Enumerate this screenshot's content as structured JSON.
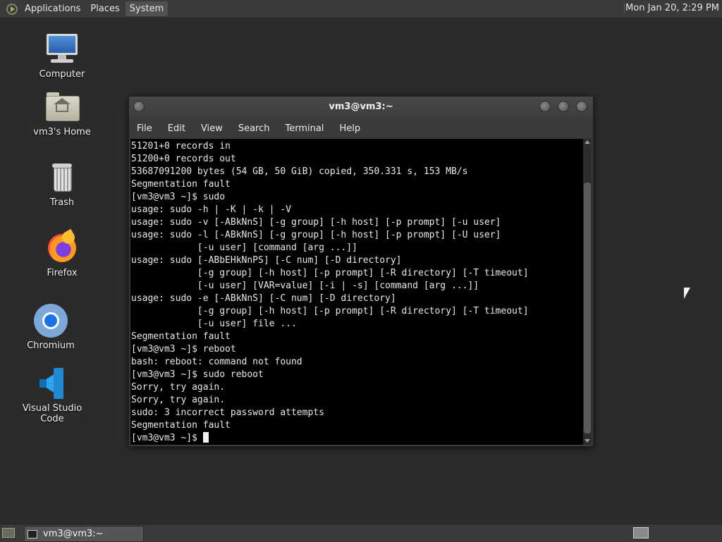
{
  "top_panel": {
    "menus": [
      "Applications",
      "Places",
      "System"
    ],
    "clock": "Mon Jan 20,  2:29 PM"
  },
  "desktop_icons": [
    {
      "label": "Computer",
      "icon": "computer-icon"
    },
    {
      "label": "vm3's Home",
      "icon": "home-folder-icon"
    },
    {
      "label": "Trash",
      "icon": "trash-icon"
    },
    {
      "label": "Firefox",
      "icon": "firefox-icon"
    },
    {
      "label": "Chromium",
      "icon": "chromium-icon"
    },
    {
      "label": "Visual Studio Code",
      "icon": "vscode-icon"
    }
  ],
  "terminal": {
    "title": "vm3@vm3:~",
    "menu": [
      "File",
      "Edit",
      "View",
      "Search",
      "Terminal",
      "Help"
    ],
    "lines": [
      "51201+0 records in",
      "51200+0 records out",
      "53687091200 bytes (54 GB, 50 GiB) copied, 350.331 s, 153 MB/s",
      "Segmentation fault",
      "[vm3@vm3 ~]$ sudo",
      "usage: sudo -h | -K | -k | -V",
      "usage: sudo -v [-ABkNnS] [-g group] [-h host] [-p prompt] [-u user]",
      "usage: sudo -l [-ABkNnS] [-g group] [-h host] [-p prompt] [-U user]",
      "            [-u user] [command [arg ...]]",
      "usage: sudo [-ABbEHkNnPS] [-C num] [-D directory]",
      "            [-g group] [-h host] [-p prompt] [-R directory] [-T timeout]",
      "            [-u user] [VAR=value] [-i | -s] [command [arg ...]]",
      "usage: sudo -e [-ABkNnS] [-C num] [-D directory]",
      "            [-g group] [-h host] [-p prompt] [-R directory] [-T timeout]",
      "            [-u user] file ...",
      "Segmentation fault",
      "[vm3@vm3 ~]$ reboot",
      "bash: reboot: command not found",
      "[vm3@vm3 ~]$ sudo reboot",
      "Sorry, try again.",
      "Sorry, try again.",
      "sudo: 3 incorrect password attempts",
      "Segmentation fault"
    ],
    "prompt": "[vm3@vm3 ~]$ "
  },
  "taskbar": {
    "task_label": "vm3@vm3:~"
  }
}
